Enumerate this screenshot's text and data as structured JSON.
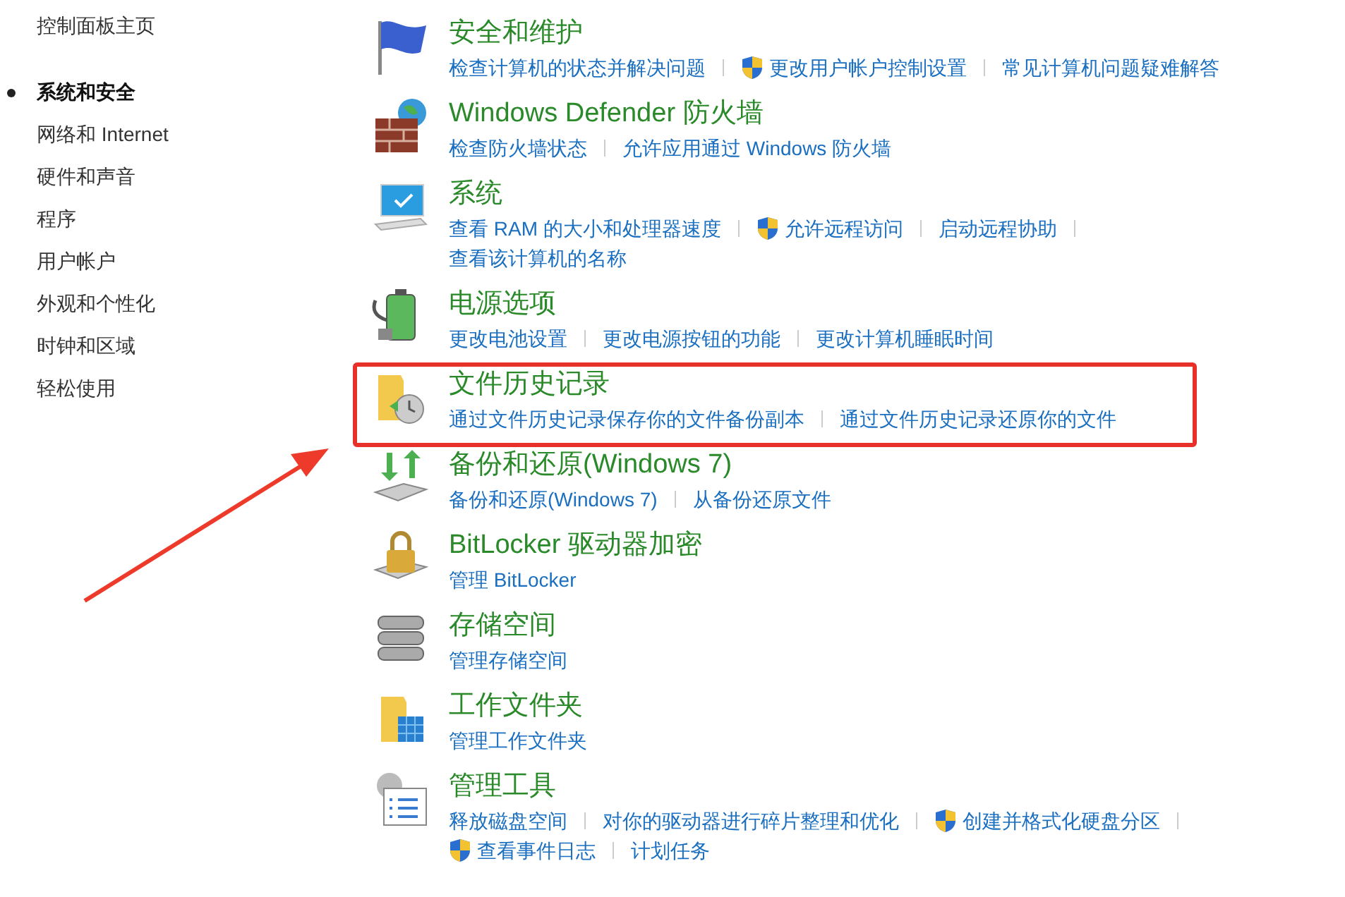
{
  "sidebar": {
    "home": "控制面板主页",
    "items": [
      {
        "label": "系统和安全",
        "selected": true
      },
      {
        "label": "网络和 Internet",
        "selected": false
      },
      {
        "label": "硬件和声音",
        "selected": false
      },
      {
        "label": "程序",
        "selected": false
      },
      {
        "label": "用户帐户",
        "selected": false
      },
      {
        "label": "外观和个性化",
        "selected": false
      },
      {
        "label": "时钟和区域",
        "selected": false
      },
      {
        "label": "轻松使用",
        "selected": false
      }
    ]
  },
  "sections": [
    {
      "title": "安全和维护",
      "highlighted": false,
      "link_rows": [
        [
          {
            "text": "检查计算机的状态并解决问题",
            "shield": false
          },
          {
            "text": "更改用户帐户控制设置",
            "shield": true
          },
          {
            "text": "常见计算机问题疑难解答",
            "shield": false
          }
        ]
      ]
    },
    {
      "title": "Windows Defender 防火墙",
      "highlighted": false,
      "link_rows": [
        [
          {
            "text": "检查防火墙状态",
            "shield": false
          },
          {
            "text": "允许应用通过 Windows 防火墙",
            "shield": false
          }
        ]
      ]
    },
    {
      "title": "系统",
      "highlighted": false,
      "link_rows": [
        [
          {
            "text": "查看 RAM 的大小和处理器速度",
            "shield": false
          },
          {
            "text": "允许远程访问",
            "shield": true
          },
          {
            "text": "启动远程协助",
            "shield": false
          }
        ],
        [
          {
            "text": "查看该计算机的名称",
            "shield": false
          }
        ]
      ]
    },
    {
      "title": "电源选项",
      "highlighted": false,
      "link_rows": [
        [
          {
            "text": "更改电池设置",
            "shield": false
          },
          {
            "text": "更改电源按钮的功能",
            "shield": false
          },
          {
            "text": "更改计算机睡眠时间",
            "shield": false
          }
        ]
      ]
    },
    {
      "title": "文件历史记录",
      "highlighted": true,
      "link_rows": [
        [
          {
            "text": "通过文件历史记录保存你的文件备份副本",
            "shield": false
          },
          {
            "text": "通过文件历史记录还原你的文件",
            "shield": false
          }
        ]
      ]
    },
    {
      "title": "备份和还原(Windows 7)",
      "highlighted": false,
      "link_rows": [
        [
          {
            "text": "备份和还原(Windows 7)",
            "shield": false
          },
          {
            "text": "从备份还原文件",
            "shield": false
          }
        ]
      ]
    },
    {
      "title": "BitLocker 驱动器加密",
      "highlighted": false,
      "link_rows": [
        [
          {
            "text": "管理 BitLocker",
            "shield": false
          }
        ]
      ]
    },
    {
      "title": "存储空间",
      "highlighted": false,
      "link_rows": [
        [
          {
            "text": "管理存储空间",
            "shield": false
          }
        ]
      ]
    },
    {
      "title": "工作文件夹",
      "highlighted": false,
      "link_rows": [
        [
          {
            "text": "管理工作文件夹",
            "shield": false
          }
        ]
      ]
    },
    {
      "title": "管理工具",
      "highlighted": false,
      "link_rows": [
        [
          {
            "text": "释放磁盘空间",
            "shield": false
          },
          {
            "text": "对你的驱动器进行碎片整理和优化",
            "shield": false
          },
          {
            "text": "创建并格式化硬盘分区",
            "shield": true
          }
        ],
        [
          {
            "text": "查看事件日志",
            "shield": true
          },
          {
            "text": "计划任务",
            "shield": false
          }
        ]
      ]
    }
  ]
}
